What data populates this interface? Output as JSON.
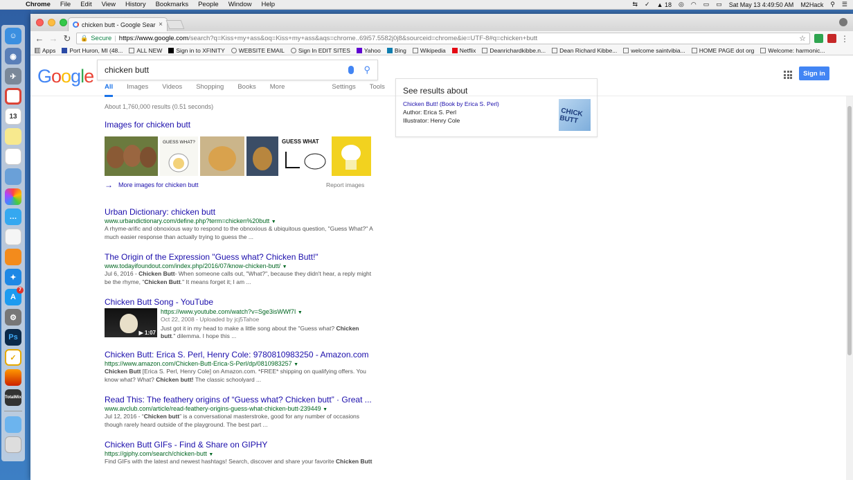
{
  "menubar": {
    "app": "Chrome",
    "items": [
      "File",
      "Edit",
      "View",
      "History",
      "Bookmarks",
      "People",
      "Window",
      "Help"
    ],
    "status": {
      "adobe_count": "18",
      "datetime": "Sat May 13  4:49:50 AM",
      "user": "M2Hack"
    }
  },
  "dock": {
    "calendar_day": "13",
    "appstore_badge": "7",
    "totalmix_label": "TotalMix"
  },
  "browser": {
    "tab_title": "chicken butt - Google Search",
    "tab_close": "×",
    "secure_label": "Secure",
    "url_host": "https://www.google.com",
    "url_rest": "/search?q=Kiss+my+ass&oq=Kiss+my+ass&aqs=chrome..69i57.5582j0j8&sourceid=chrome&ie=UTF-8#q=chicken+butt",
    "bookmarks": [
      "Apps",
      "Port Huron, MI (48...",
      "ALL NEW",
      "Sign in to XFINITY",
      "WEBSITE EMAIL",
      "Sign In EDIT SITES",
      "Yahoo",
      "Bing",
      "Wikipedia",
      "Netflix",
      "Deanrichardkibbe.n...",
      "Dean Richard Kibbe...",
      "welcome saintvibia...",
      "HOME PAGE dot org",
      "Welcome: harmonic..."
    ]
  },
  "google": {
    "logo": [
      "G",
      "o",
      "o",
      "g",
      "l",
      "e"
    ],
    "query": "chicken butt",
    "signin": "Sign in",
    "tabs": [
      "All",
      "Images",
      "Videos",
      "Shopping",
      "Books",
      "More"
    ],
    "tools": [
      "Settings",
      "Tools"
    ],
    "stats": "About 1,760,000 results (0.51 seconds)",
    "images_header": "Images for chicken butt",
    "more_images": "More images for chicken butt",
    "report_images": "Report images",
    "thumb_texts": {
      "guess_small": "GUESS WHAT?",
      "guess_big": "GUESS WHAT"
    },
    "results": [
      {
        "title": "Urban Dictionary: chicken butt",
        "url": "www.urbandictionary.com/define.php?term=chicken%20butt",
        "snippet": "A rhyme-arific and obnoxious way to respond to the obnoxious & ubiquitous question, \"Guess What?\" A much easier response than actually trying to guess the ..."
      },
      {
        "title": "The Origin of the Expression \"Guess what? Chicken Butt!\"",
        "url": "www.todayifoundout.com/index.php/2016/07/know-chicken-butt/",
        "snippet_date": "Jul 6, 2016 - ",
        "snippet_bold1": "Chicken Butt",
        "snippet_mid": "- When someone calls out, \"What?\", because they didn't hear, a reply might be the rhyme, \"",
        "snippet_bold2": "Chicken Butt",
        "snippet_end": ".\" It means forget it; I am ..."
      },
      {
        "title": "Chicken Butt Song - YouTube",
        "url": "https://www.youtube.com/watch?v=Sge3isWWf7I",
        "meta": "Oct 22, 2008 - Uploaded by jcj5Tahoe",
        "snippet_a": "Just got it in my head to make a little song about the \"Guess what? ",
        "snippet_bold": "Chicken butt",
        "snippet_b": ".\" dilemma. I hope this ...",
        "duration": "1:07"
      },
      {
        "title": "Chicken Butt: Erica S. Perl, Henry Cole: 9780810983250 - Amazon.com",
        "url": "https://www.amazon.com/Chicken-Butt-Erica-S-Perl/dp/0810983257",
        "snippet_bold1": "Chicken Butt",
        "snippet_mid": " [Erica S. Perl, Henry Cole] on Amazon.com. *FREE* shipping on qualifying offers. You know what? What? ",
        "snippet_bold2": "Chicken butt!",
        "snippet_end": " The classic schoolyard ..."
      },
      {
        "title": "Read This: The feathery origins of “Guess what? Chicken butt” · Great ...",
        "url": "www.avclub.com/article/read-feathery-origins-guess-what-chicken-butt-239449",
        "snippet_date": "Jul 12, 2016 - “",
        "snippet_bold": "Chicken butt",
        "snippet_end": "” is a conversational masterstroke, good for any number of occasions though rarely heard outside of the playground. The best part ..."
      },
      {
        "title": "Chicken Butt GIFs - Find & Share on GIPHY",
        "url": "https://giphy.com/search/chicken-butt",
        "snippet_a": "Find GIFs with the latest and newest hashtags! Search, discover and share your favorite ",
        "snippet_bold": "Chicken Butt"
      }
    ],
    "knowledge_panel": {
      "heading": "See results about",
      "link": "Chicken Butt! (Book by Erica S. Perl)",
      "author": "Author: Erica S. Perl",
      "illustrator": "Illustrator: Henry Cole",
      "cover_text": "CHICK BUTT"
    }
  }
}
